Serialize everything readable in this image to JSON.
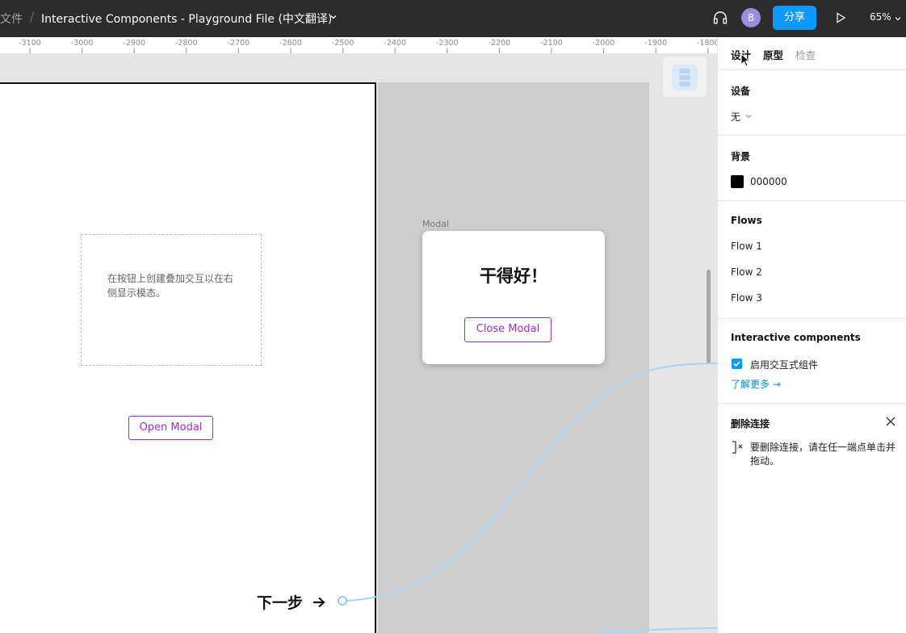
{
  "topbar": {
    "breadcrumb_parent": "文件",
    "file_title": "Interactive Components - Playground File (中文翻译)",
    "avatar_initial": "B",
    "share_label": "分享",
    "zoom_label": "65%"
  },
  "ruler": {
    "ticks": [
      "-3100",
      "-3000",
      "-2900",
      "-2800",
      "-2700",
      "-2600",
      "-2500",
      "-2400",
      "-2300",
      "-2200",
      "-2100",
      "-2000",
      "-1900",
      "-1800"
    ]
  },
  "canvas": {
    "hint_text": "在按钮上创建叠加交互以在右侧显示模态。",
    "open_modal_label": "Open Modal",
    "modal_frame_label": "Modal",
    "modal_title": "干得好！",
    "close_modal_label": "Close Modal",
    "next_step_label": "下一步"
  },
  "panel": {
    "tabs": [
      {
        "label": "设计",
        "active": true
      },
      {
        "label": "原型",
        "active": false
      },
      {
        "label": "检查",
        "active": false
      }
    ],
    "device": {
      "title": "设备",
      "value": "无"
    },
    "background": {
      "title": "背景",
      "color": "#000000",
      "value": "000000"
    },
    "flows": {
      "title": "Flows",
      "items": [
        "Flow 1",
        "Flow 2",
        "Flow 3"
      ]
    },
    "interactive": {
      "title": "Interactive components",
      "checkbox_label": "启用交互式组件",
      "checked": true,
      "learn_more": "了解更多 →"
    },
    "delete_connection": {
      "title": "删除连接",
      "description": "要删除连接，请在任一端点单击并拖动。"
    }
  },
  "colors": {
    "accent": "#0d99ff",
    "modal_button": "#9b30c8",
    "connector": "#a9d6f5",
    "topbar": "#2c2c2c"
  }
}
